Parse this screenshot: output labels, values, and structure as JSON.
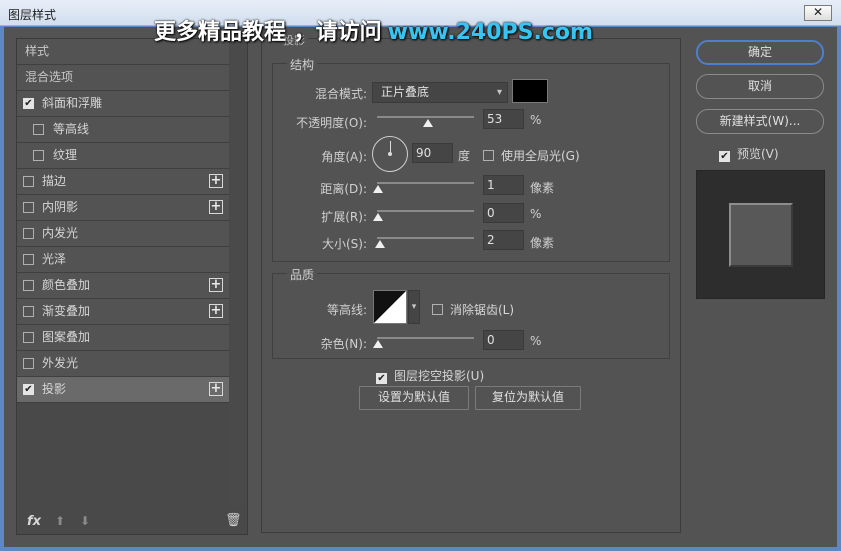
{
  "window": {
    "title": "图层样式",
    "close": "✕"
  },
  "watermark": {
    "text": "更多精品教程 ，请访问",
    "url": "www.240PS.com"
  },
  "left": {
    "header_styles": "样式",
    "header_blend": "混合选项",
    "items": [
      {
        "label": "斜面和浮雕",
        "checked": true,
        "indent": false,
        "plus": false,
        "selected": false
      },
      {
        "label": "等高线",
        "checked": false,
        "indent": true,
        "plus": false,
        "selected": false
      },
      {
        "label": "纹理",
        "checked": false,
        "indent": true,
        "plus": false,
        "selected": false
      },
      {
        "label": "描边",
        "checked": false,
        "indent": false,
        "plus": true,
        "selected": false
      },
      {
        "label": "内阴影",
        "checked": false,
        "indent": false,
        "plus": true,
        "selected": false
      },
      {
        "label": "内发光",
        "checked": false,
        "indent": false,
        "plus": false,
        "selected": false
      },
      {
        "label": "光泽",
        "checked": false,
        "indent": false,
        "plus": false,
        "selected": false
      },
      {
        "label": "颜色叠加",
        "checked": false,
        "indent": false,
        "plus": true,
        "selected": false
      },
      {
        "label": "渐变叠加",
        "checked": false,
        "indent": false,
        "plus": true,
        "selected": false
      },
      {
        "label": "图案叠加",
        "checked": false,
        "indent": false,
        "plus": false,
        "selected": false
      },
      {
        "label": "外发光",
        "checked": false,
        "indent": false,
        "plus": false,
        "selected": false
      },
      {
        "label": "投影",
        "checked": true,
        "indent": false,
        "plus": true,
        "selected": true
      }
    ],
    "footer": {
      "fx": "fx",
      "up_icon": "arrow-up-icon",
      "down_icon": "arrow-down-icon",
      "trash_icon": "trash-icon"
    }
  },
  "structure": {
    "section_label": "投影",
    "group_label": "结构",
    "blend_mode_label": "混合模式:",
    "blend_mode_value": "正片叠底",
    "shadow_color": "#000000",
    "opacity_label": "不透明度(O):",
    "opacity_value": "53",
    "opacity_unit": "%",
    "angle_label": "角度(A):",
    "angle_value": "90",
    "angle_unit": "度",
    "global_light_label": "使用全局光(G)",
    "global_light_checked": false,
    "distance_label": "距离(D):",
    "distance_value": "1",
    "distance_unit": "像素",
    "spread_label": "扩展(R):",
    "spread_value": "0",
    "spread_unit": "%",
    "size_label": "大小(S):",
    "size_value": "2",
    "size_unit": "像素"
  },
  "quality": {
    "group_label": "品质",
    "contour_label": "等高线:",
    "antialias_label": "消除锯齿(L)",
    "antialias_checked": false,
    "noise_label": "杂色(N):",
    "noise_value": "0",
    "noise_unit": "%"
  },
  "knockout": {
    "label": "图层挖空投影(U)",
    "checked": true
  },
  "buttons": {
    "make_default": "设置为默认值",
    "reset_default": "复位为默认值",
    "ok": "确定",
    "cancel": "取消",
    "new_style": "新建样式(W)...",
    "preview_label": "预览(V)",
    "preview_checked": true
  },
  "colors": {
    "accent": "#4d7fcf",
    "panel_bg": "#535353"
  }
}
